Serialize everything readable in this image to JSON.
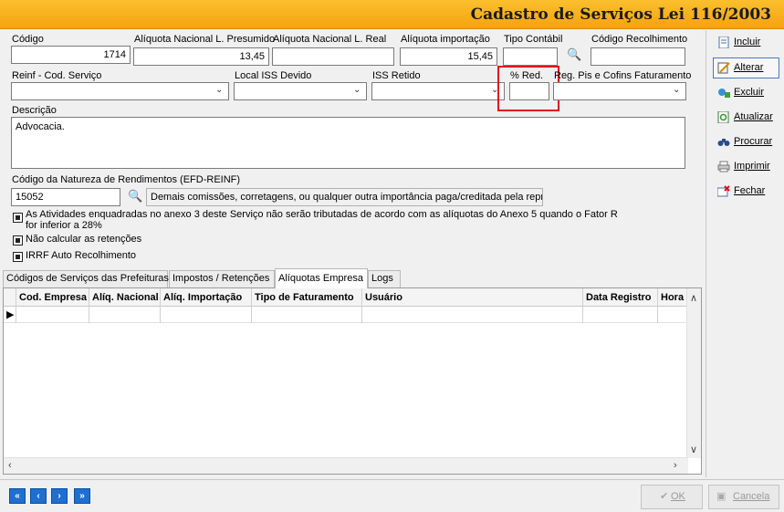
{
  "window": {
    "title": "Cadastro de Serviços Lei 116/2003"
  },
  "fields": {
    "codigo": {
      "label": "Código",
      "value": "1714"
    },
    "aliq_presumido": {
      "label": "Alíquota Nacional L. Presumido",
      "value": "13,45"
    },
    "aliq_real": {
      "label": "Alíquota Nacional L. Real",
      "value": ""
    },
    "aliq_importacao": {
      "label": "Alíquota importação",
      "value": "15,45"
    },
    "tipo_contabil": {
      "label": "Tipo Contábil",
      "value": ""
    },
    "codigo_recolhimento": {
      "label": "Código Recolhimento",
      "value": ""
    },
    "reinf": {
      "label": "Reinf - Cod. Serviço",
      "value": ""
    },
    "local_iss": {
      "label": "Local ISS Devido",
      "value": ""
    },
    "iss_retido": {
      "label": "ISS Retido",
      "value": ""
    },
    "pct_red": {
      "label": "% Red.",
      "value": ""
    },
    "reg_pis": {
      "label": "Reg. Pis e Cofins Faturamento",
      "value": ""
    },
    "descricao": {
      "label": "Descrição",
      "value": "Advocacia."
    },
    "natureza": {
      "label": "Código da Natureza de Rendimentos (EFD-REINF)",
      "code": "15052",
      "description": "Demais comissões, corretagens, ou qualquer outra importância paga/creditada pela represe"
    }
  },
  "checkboxes": {
    "anexo3_line1": "As Atividades enquadradas no anexo 3 deste Serviço não serão tributadas de acordo com as alíquotas do Anexo 5 quando o Fator R",
    "anexo3_line2": "for inferior a 28%",
    "nao_calcular": "Não calcular as retenções",
    "irrf": "IRRF Auto Recolhimento"
  },
  "tabs": [
    {
      "label": "Códigos de Serviços das Prefeituras"
    },
    {
      "label": "Impostos / Retenções"
    },
    {
      "label": "Alíquotas Empresa",
      "active": true
    },
    {
      "label": "Logs"
    }
  ],
  "grid": {
    "columns": [
      "Cod. Empresa",
      "Alíq. Nacional",
      "Alíq. Importação",
      "Tipo de Faturamento",
      "Usuário",
      "Data Registro",
      "Hora"
    ]
  },
  "sidebar": {
    "incluir": "Incluir",
    "alterar": "Alterar",
    "excluir": "Excluir",
    "atualizar": "Atualizar",
    "procurar": "Procurar",
    "imprimir": "Imprimir",
    "fechar": "Fechar"
  },
  "footer": {
    "ok": "OK",
    "cancela": "Cancela"
  },
  "colors": {
    "title_bar": "#f5a30e",
    "highlight": "#e5141b",
    "nav": "#1f6fd1"
  }
}
